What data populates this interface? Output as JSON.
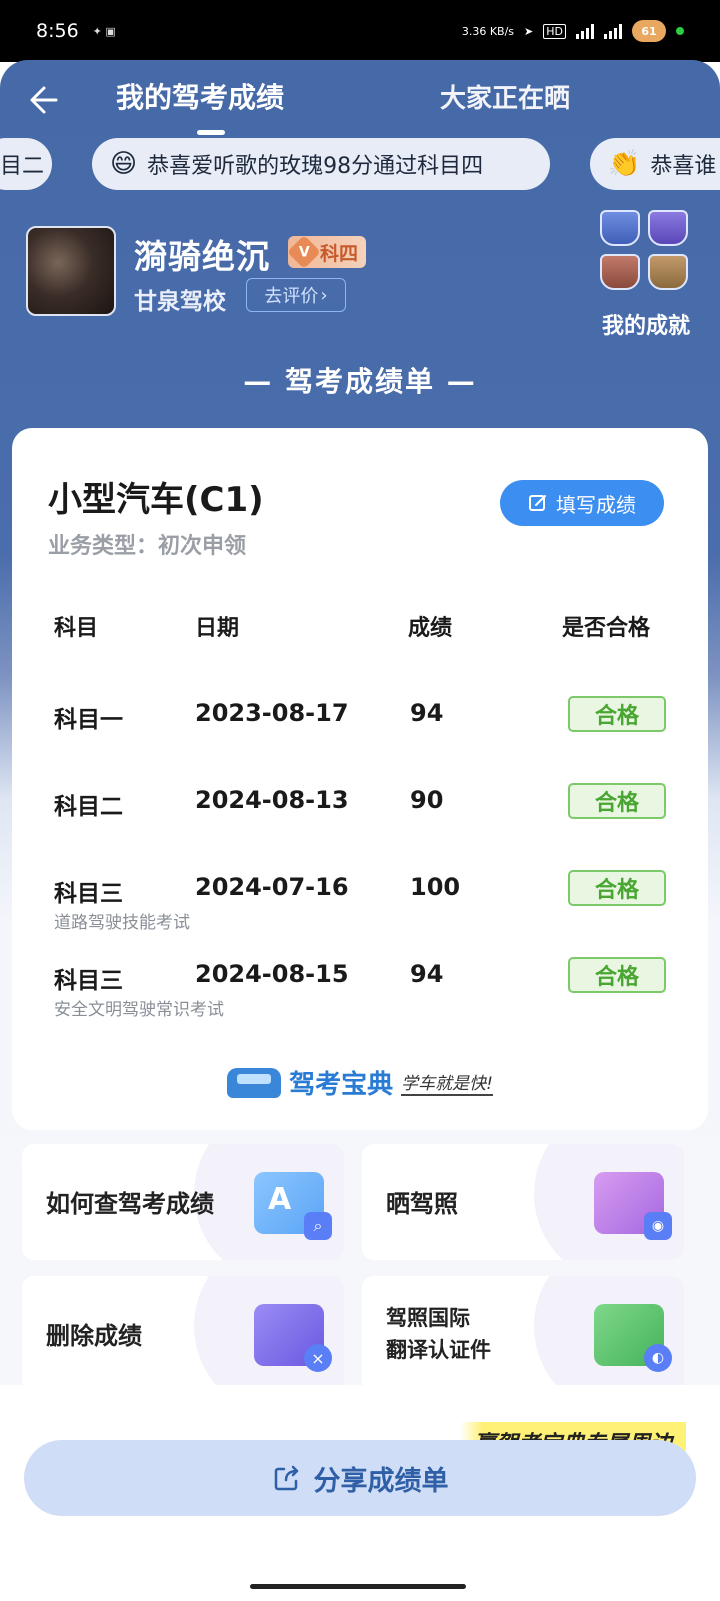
{
  "status_bar": {
    "time": "8:56",
    "net_speed": "3.36 KB/s",
    "battery": "61"
  },
  "nav": {
    "tab_active": "我的驾考成绩",
    "tab_other": "大家正在晒"
  },
  "ticker": [
    {
      "emoji": "",
      "text": "目二"
    },
    {
      "emoji": "😄",
      "text": "恭喜爱听歌的玫瑰98分通过科目四"
    },
    {
      "emoji": "👏",
      "text": "恭喜谁"
    }
  ],
  "profile": {
    "name": "漪骑绝沉",
    "badge": "科四",
    "school": "甘泉驾校",
    "rate_button": "去评价",
    "achievements_label": "我的成就"
  },
  "section_title": "— 驾考成绩单 —",
  "card": {
    "license": "小型汽车(C1)",
    "business_type": "业务类型：初次申领",
    "fill_button": "填写成绩",
    "headers": {
      "subject": "科目",
      "date": "日期",
      "score": "成绩",
      "passed": "是否合格"
    },
    "rows": [
      {
        "subject": "科目一",
        "date": "2023-08-17",
        "score": "94",
        "status": "合格",
        "note": ""
      },
      {
        "subject": "科目二",
        "date": "2024-08-13",
        "score": "90",
        "status": "合格",
        "note": ""
      },
      {
        "subject": "科目三",
        "date": "2024-07-16",
        "score": "100",
        "status": "合格",
        "note": "道路驾驶技能考试"
      },
      {
        "subject": "科目三",
        "date": "2024-08-15",
        "score": "94",
        "status": "合格",
        "note": "安全文明驾驶常识考试"
      }
    ],
    "brand_name": "驾考宝典",
    "brand_slogan": "学车就是快!"
  },
  "tiles": [
    {
      "label": "如何查驾考成绩"
    },
    {
      "label": "晒驾照"
    },
    {
      "label": "删除成绩"
    },
    {
      "label_line1": "驾照国际",
      "label_line2": "翻译认证件"
    }
  ],
  "promo": "赢驾考宝典专属周边",
  "share_button": "分享成绩单",
  "colors": {
    "header_blue": "#4669a7",
    "accent_blue": "#3c8ef0",
    "pass_green": "#4aa633",
    "share_bg": "#cfddf6"
  }
}
